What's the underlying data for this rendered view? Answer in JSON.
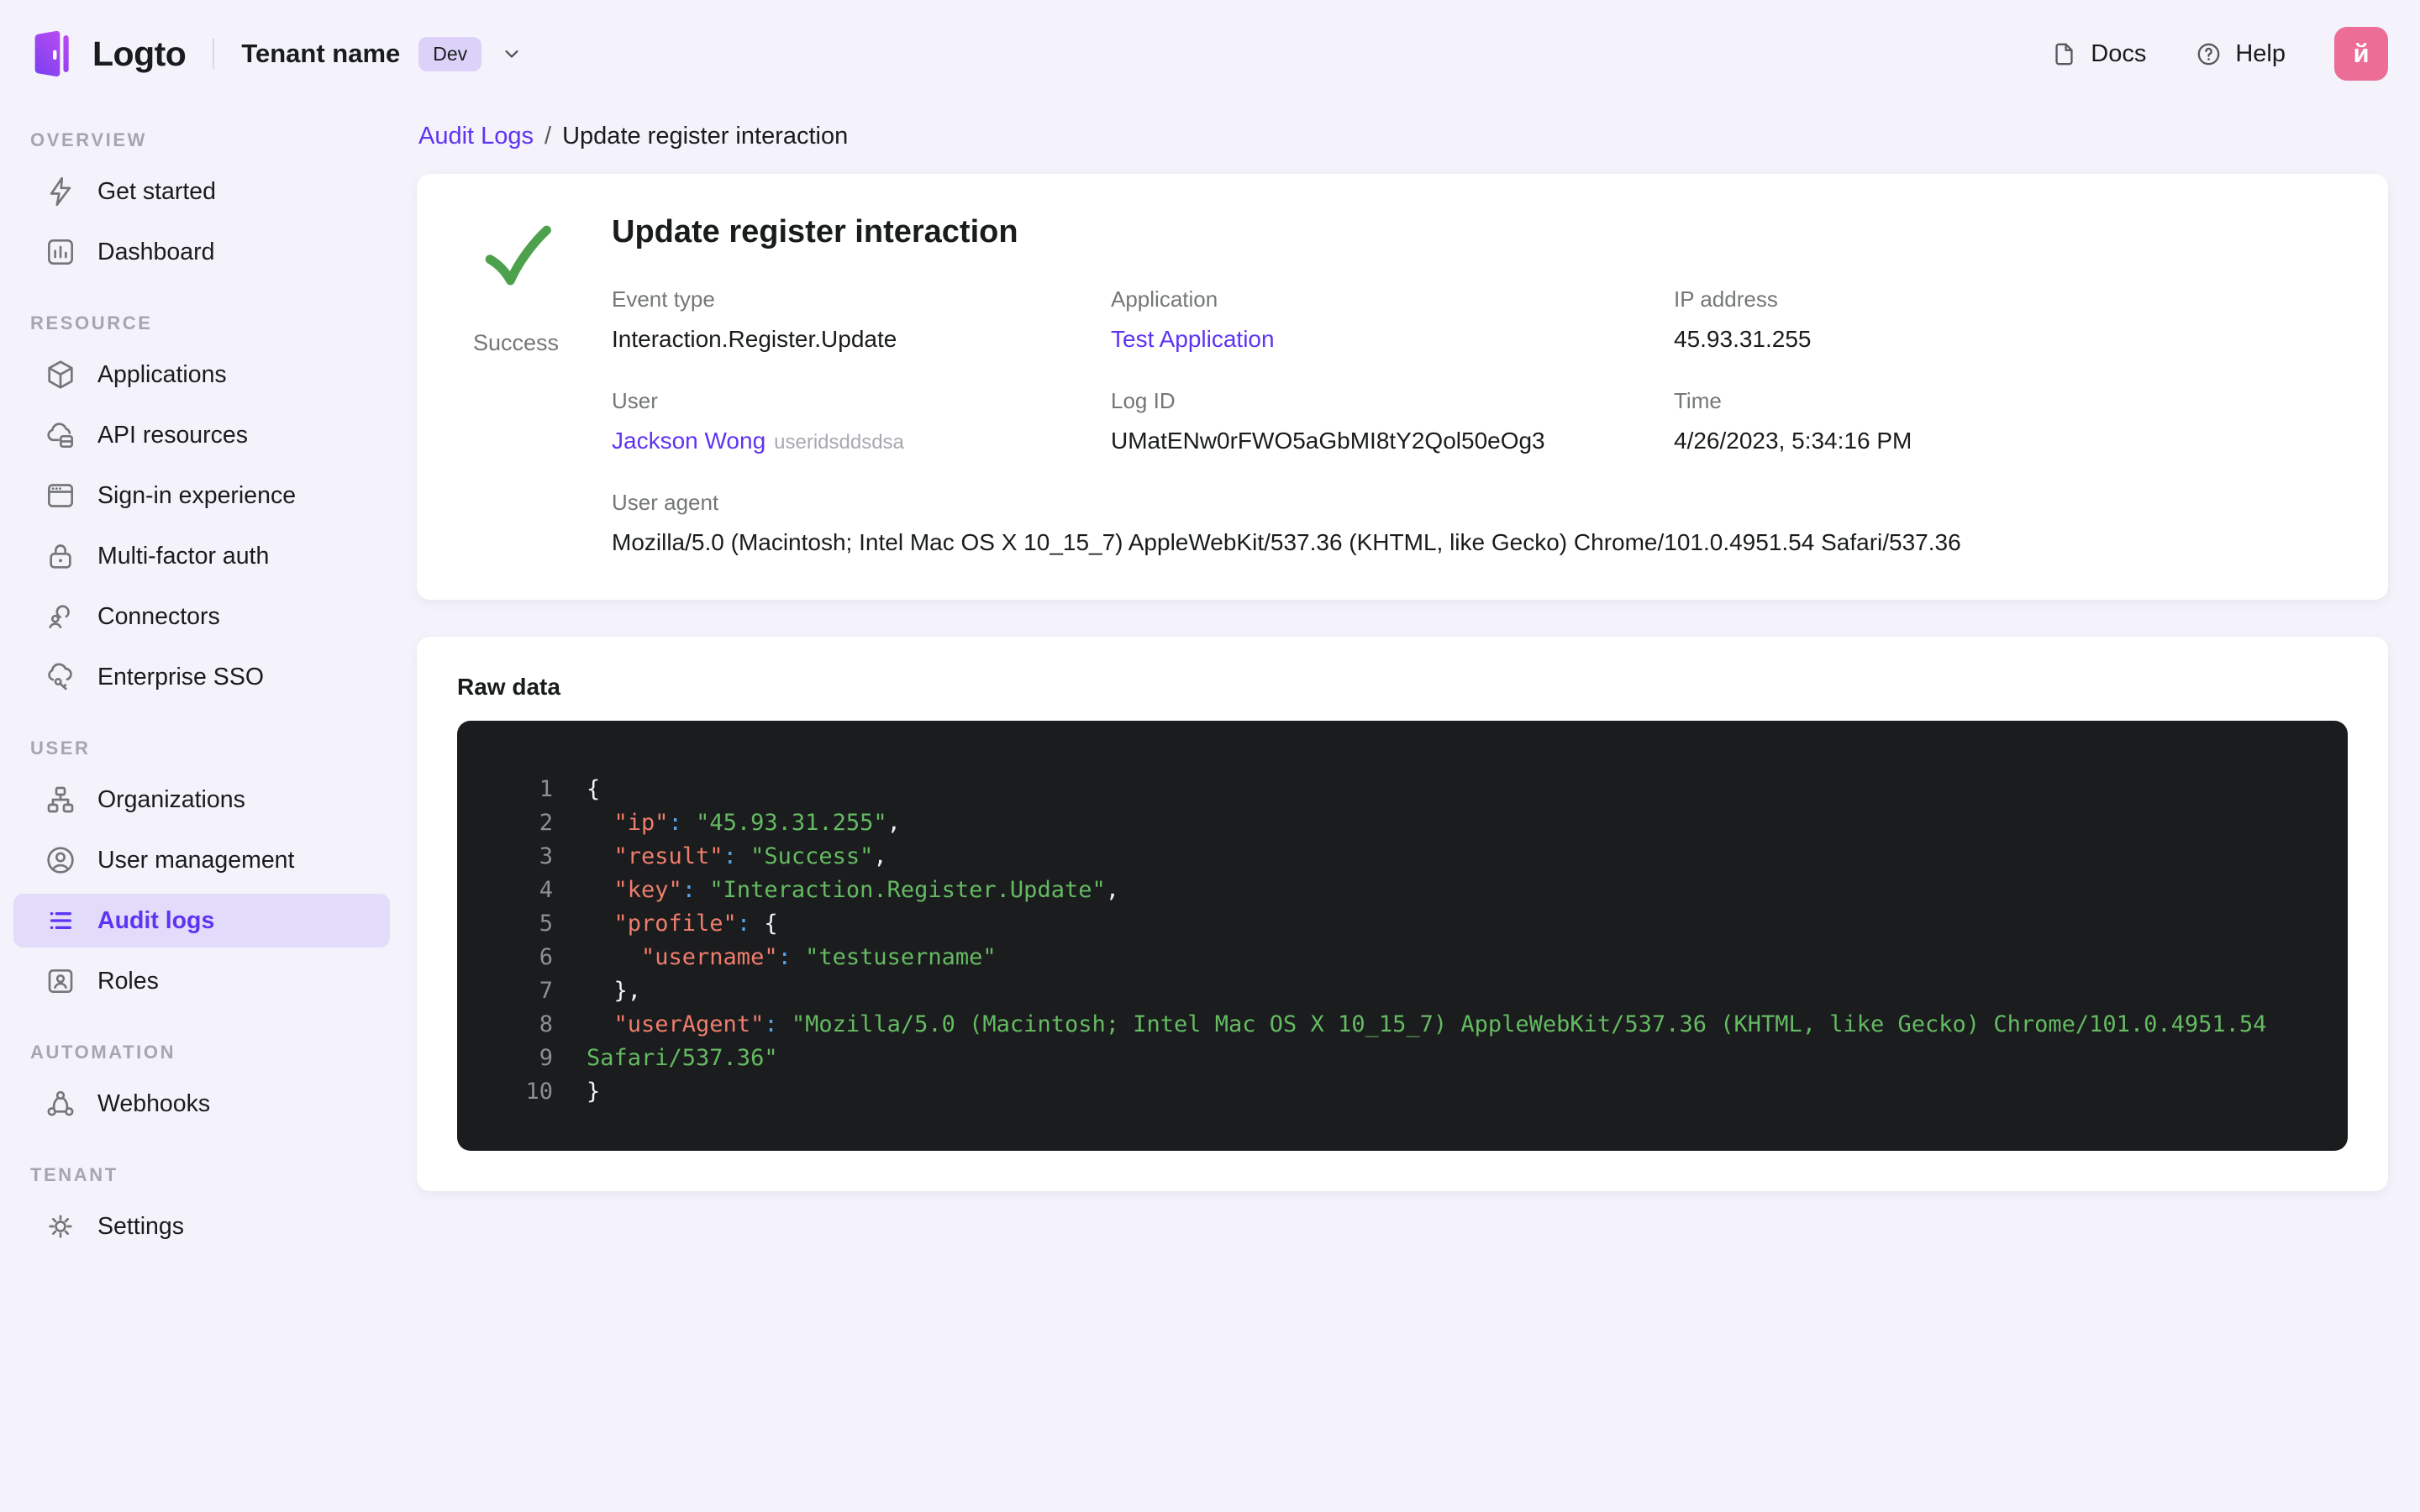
{
  "header": {
    "logo_text": "Logto",
    "tenant_name": "Tenant name",
    "tenant_badge": "Dev",
    "docs_label": "Docs",
    "help_label": "Help",
    "avatar_letter": "й"
  },
  "sidebar": {
    "sections": [
      {
        "label": "OVERVIEW",
        "items": [
          {
            "icon": "bolt",
            "label": "Get started",
            "active": false
          },
          {
            "icon": "dashboard",
            "label": "Dashboard",
            "active": false
          }
        ]
      },
      {
        "label": "RESOURCE",
        "items": [
          {
            "icon": "cube",
            "label": "Applications",
            "active": false
          },
          {
            "icon": "cloud-stack",
            "label": "API resources",
            "active": false
          },
          {
            "icon": "browser",
            "label": "Sign-in experience",
            "active": false
          },
          {
            "icon": "lock",
            "label": "Multi-factor auth",
            "active": false
          },
          {
            "icon": "connectors",
            "label": "Connectors",
            "active": false
          },
          {
            "icon": "cloud-key",
            "label": "Enterprise SSO",
            "active": false
          }
        ]
      },
      {
        "label": "USER",
        "items": [
          {
            "icon": "org-tree",
            "label": "Organizations",
            "active": false
          },
          {
            "icon": "user-circle",
            "label": "User management",
            "active": false
          },
          {
            "icon": "list",
            "label": "Audit logs",
            "active": true
          },
          {
            "icon": "id-card",
            "label": "Roles",
            "active": false
          }
        ]
      },
      {
        "label": "AUTOMATION",
        "items": [
          {
            "icon": "webhook",
            "label": "Webhooks",
            "active": false
          }
        ]
      },
      {
        "label": "TENANT",
        "items": [
          {
            "icon": "gear",
            "label": "Settings",
            "active": false
          }
        ]
      }
    ]
  },
  "breadcrumb": {
    "parent": "Audit Logs",
    "separator": "/",
    "current": "Update register interaction"
  },
  "detail": {
    "title": "Update register interaction",
    "status": "Success",
    "status_color": "#4da14c",
    "rows": [
      {
        "cells": [
          {
            "label": "Event type",
            "value": "Interaction.Register.Update",
            "type": "text"
          },
          {
            "label": "Application",
            "value": "Test Application",
            "type": "link"
          },
          {
            "label": "IP address",
            "value": "45.93.31.255",
            "type": "text"
          }
        ]
      },
      {
        "cells": [
          {
            "label": "User",
            "value": "Jackson Wong",
            "suffix": "useridsddsdsa",
            "type": "link"
          },
          {
            "label": "Log ID",
            "value": "UMatENw0rFWO5aGbMI8tY2Qol50eOg3",
            "type": "text"
          },
          {
            "label": "Time",
            "value": "4/26/2023, 5:34:16 PM",
            "type": "text"
          }
        ]
      },
      {
        "cells": [
          {
            "label": "User agent",
            "value": "Mozilla/5.0 (Macintosh; Intel Mac OS X 10_15_7) AppleWebKit/537.36 (KHTML, like Gecko) Chrome/101.0.4951.54 Safari/537.36",
            "type": "text",
            "full": true
          }
        ]
      }
    ]
  },
  "raw": {
    "heading": "Raw data",
    "colors": {
      "background": "#1a1c1d",
      "key": "#ef7d6d",
      "colon": "#55a3e8",
      "string": "#65ba62",
      "punctuation": "#f2f3f3",
      "line_number": "#8d9091"
    },
    "lines": [
      {
        "n": "1",
        "tokens": [
          {
            "t": "punc",
            "v": "{"
          }
        ]
      },
      {
        "n": "2",
        "tokens": [
          {
            "t": "key",
            "v": "  \"ip\""
          },
          {
            "t": "colon",
            "v": ": "
          },
          {
            "t": "str",
            "v": "\"45.93.31.255\""
          },
          {
            "t": "punc",
            "v": ","
          }
        ]
      },
      {
        "n": "3",
        "tokens": [
          {
            "t": "key",
            "v": "  \"result\""
          },
          {
            "t": "colon",
            "v": ": "
          },
          {
            "t": "str",
            "v": "\"Success\""
          },
          {
            "t": "punc",
            "v": ","
          }
        ]
      },
      {
        "n": "4",
        "tokens": [
          {
            "t": "key",
            "v": "  \"key\""
          },
          {
            "t": "colon",
            "v": ": "
          },
          {
            "t": "str",
            "v": "\"Interaction.Register.Update\""
          },
          {
            "t": "punc",
            "v": ","
          }
        ]
      },
      {
        "n": "5",
        "tokens": [
          {
            "t": "key",
            "v": "  \"profile\""
          },
          {
            "t": "colon",
            "v": ": "
          },
          {
            "t": "punc",
            "v": "{"
          }
        ]
      },
      {
        "n": "6",
        "tokens": [
          {
            "t": "key",
            "v": "    \"username\""
          },
          {
            "t": "colon",
            "v": ": "
          },
          {
            "t": "str",
            "v": "\"testusername\""
          }
        ]
      },
      {
        "n": "7",
        "tokens": [
          {
            "t": "punc",
            "v": "  },"
          }
        ]
      },
      {
        "n": "8",
        "tokens": [
          {
            "t": "key",
            "v": "  \"userAgent\""
          },
          {
            "t": "colon",
            "v": ": "
          },
          {
            "t": "str",
            "v": "\"Mozilla/5.0 (Macintosh; Intel Mac OS X 10_15_7) AppleWebKit/537.36 (KHTML, like Gecko) Chrome/101.0.4951.54"
          }
        ]
      },
      {
        "n": "9",
        "tokens": [
          {
            "t": "str",
            "v": "Safari/537.36\""
          }
        ]
      },
      {
        "n": "10",
        "tokens": [
          {
            "t": "punc",
            "v": "}"
          }
        ]
      }
    ]
  }
}
